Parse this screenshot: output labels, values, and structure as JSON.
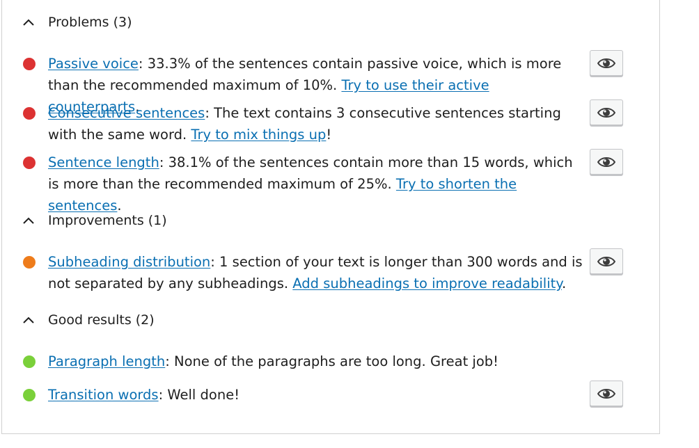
{
  "colors": {
    "problem": "#dc3232",
    "improvement": "#ee7c1b",
    "good": "#7ad03a",
    "link": "#0a6fb2"
  },
  "sections": [
    {
      "title": "Problems (3)",
      "icon": "chevron-up-icon",
      "items": [
        {
          "link": "Passive voice",
          "text": ": 33.3% of the sentences contain passive voice, which is more than the recommended maximum of 10%. ",
          "cta": "Try to use their active counterparts",
          "end": ".",
          "eye_icon": "eye-icon"
        },
        {
          "link": "Consecutive sentences",
          "text": ": The text contains 3 consecutive sentences starting with the same word. ",
          "cta": "Try to mix things up",
          "end": "!",
          "eye_icon": "eye-icon"
        },
        {
          "link": "Sentence length",
          "text": ": 38.1% of the sentences contain more than 15 words, which is more than the recommended maximum of 25%. ",
          "cta": "Try to shorten the sentences",
          "end": ".",
          "eye_icon": "eye-icon"
        }
      ]
    },
    {
      "title": "Improvements (1)",
      "icon": "chevron-up-icon",
      "items": [
        {
          "link": "Subheading distribution",
          "text": ": 1 section of your text is longer than 300 words and is not separated by any subheadings. ",
          "cta": "Add subheadings to improve readability",
          "end": ".",
          "eye_icon": "eye-icon"
        }
      ]
    },
    {
      "title": "Good results (2)",
      "icon": "chevron-up-icon",
      "items": [
        {
          "link": "Paragraph length",
          "text": ": None of the paragraphs are too long. Great job!"
        },
        {
          "link": "Transition words",
          "text": ": Well done!",
          "eye_icon": "eye-icon"
        }
      ]
    }
  ]
}
